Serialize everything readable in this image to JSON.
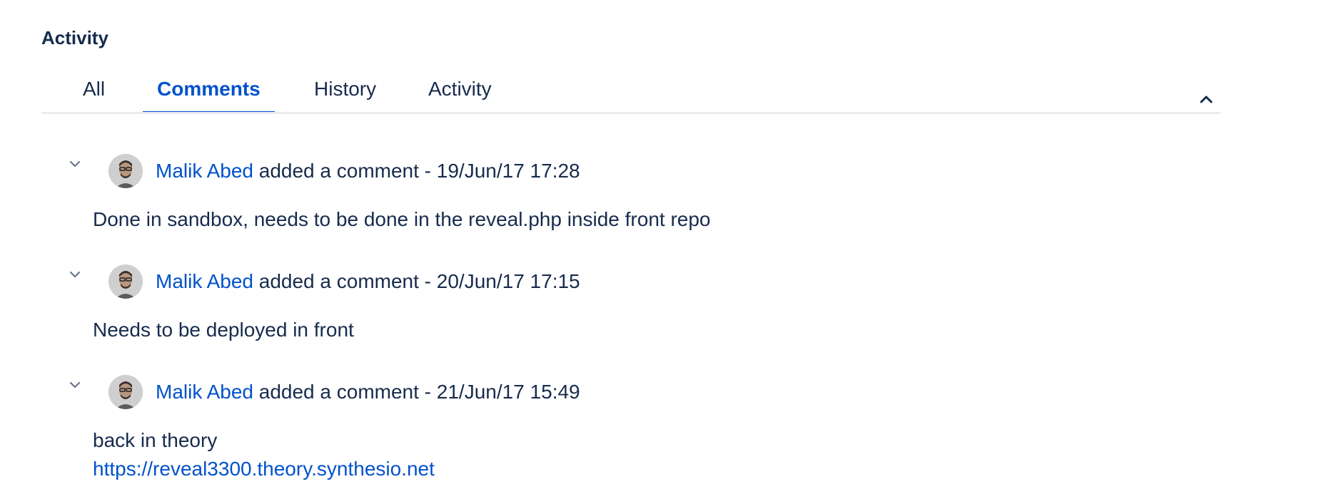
{
  "activity": {
    "title": "Activity",
    "tabs": [
      {
        "label": "All",
        "active": false
      },
      {
        "label": "Comments",
        "active": true
      },
      {
        "label": "History",
        "active": false
      },
      {
        "label": "Activity",
        "active": false
      }
    ],
    "collapse_icon": "chevron-up-icon"
  },
  "comments": [
    {
      "author": "Malik Abed",
      "action": "added a comment",
      "separator": "-",
      "timestamp": "19/Jun/17 17:28",
      "body": "Done in sandbox, needs to be done in the reveal.php inside front repo",
      "link": ""
    },
    {
      "author": "Malik Abed",
      "action": "added a comment",
      "separator": "-",
      "timestamp": "20/Jun/17 17:15",
      "body": "Needs to be deployed in front",
      "link": ""
    },
    {
      "author": "Malik Abed",
      "action": "added a comment",
      "separator": "-",
      "timestamp": "21/Jun/17 15:49",
      "body": "back in theory",
      "link": "https://reveal3300.theory.synthesio.net"
    }
  ],
  "colors": {
    "text": "#172b4d",
    "link": "#0052cc",
    "tab_border": "#ebecf0"
  }
}
